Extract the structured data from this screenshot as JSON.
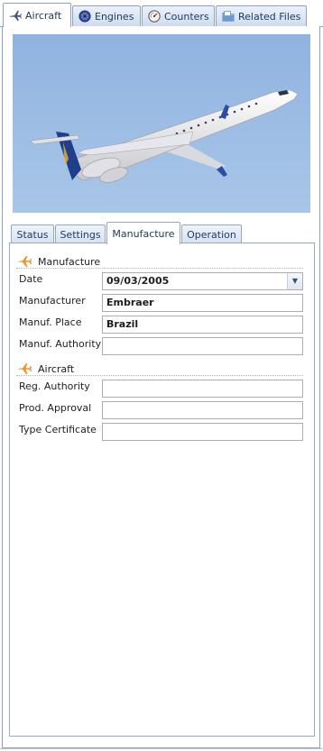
{
  "top_tabs": [
    {
      "label": "Aircraft",
      "icon": "airplane-icon",
      "active": true
    },
    {
      "label": "Engines",
      "icon": "engine-icon",
      "active": false
    },
    {
      "label": "Counters",
      "icon": "counter-gauge-icon",
      "active": false
    },
    {
      "label": "Related Files",
      "icon": "files-icon",
      "active": false
    }
  ],
  "inner_tabs": [
    {
      "label": "Status",
      "active": false
    },
    {
      "label": "Settings",
      "active": false
    },
    {
      "label": "Manufacture",
      "active": true
    },
    {
      "label": "Operation",
      "active": false
    }
  ],
  "manufacture_group": {
    "title": "Manufacture",
    "icon": "airplane-icon",
    "fields": {
      "date": {
        "label": "Date",
        "value": "09/03/2005"
      },
      "manufacturer": {
        "label": "Manufacturer",
        "value": "Embraer"
      },
      "manuf_place": {
        "label": "Manuf. Place",
        "value": "Brazil"
      },
      "manuf_authority": {
        "label": "Manuf. Authority",
        "value": ""
      }
    }
  },
  "aircraft_group": {
    "title": "Aircraft",
    "icon": "airplane-icon",
    "fields": {
      "reg_authority": {
        "label": "Reg. Authority",
        "value": ""
      },
      "prod_approval": {
        "label": "Prod. Approval",
        "value": ""
      },
      "type_certificate": {
        "label": "Type Certificate",
        "value": ""
      }
    }
  },
  "colors": {
    "accent_orange": "#f0932b",
    "tab_border": "#8ea3be",
    "tab_text": "#1e395b",
    "sky": "#9dbbe0"
  }
}
